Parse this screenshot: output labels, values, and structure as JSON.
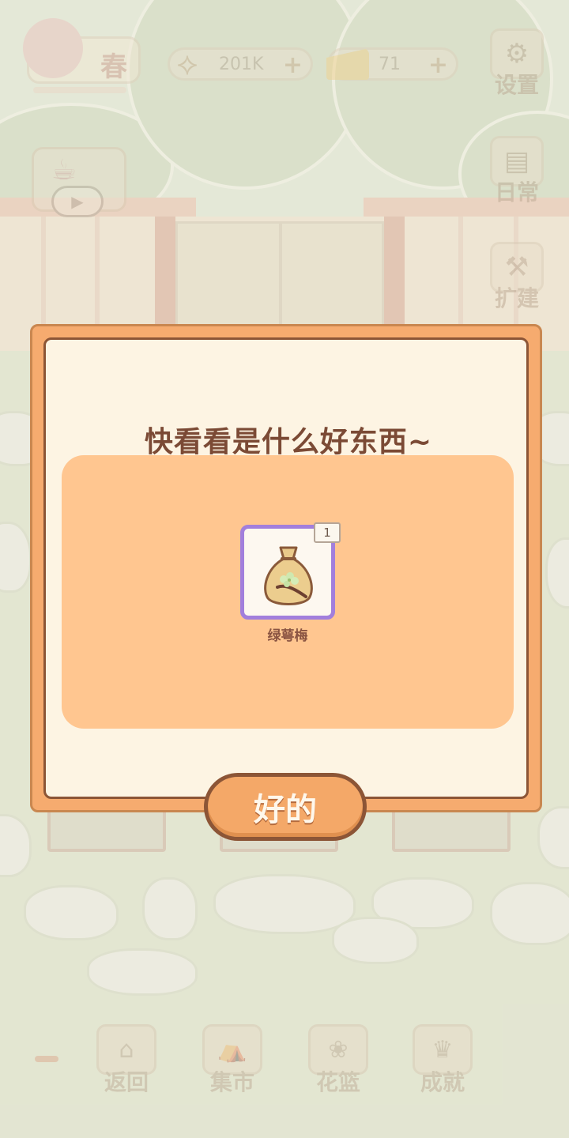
{
  "hud": {
    "season_label": "春",
    "fish_currency": "201K",
    "cheese_currency": "71",
    "plus": "+",
    "settings_label": "设置",
    "daily_label": "日常",
    "build_label": "扩建"
  },
  "nav": {
    "back_label": "返回",
    "market_label": "集市",
    "basket_label": "花篮",
    "achievements_label": "成就"
  },
  "dialog": {
    "title": "快看看是什么好东西~",
    "item": {
      "name": "绿萼梅",
      "count": "1",
      "icon": "seed-bag-icon"
    },
    "ok_label": "好的"
  },
  "colors": {
    "dialog_frame": "#f6ab6f",
    "dialog_border": "#8c5536",
    "dialog_bg": "#fdf4e3",
    "reward_area": "#ffc690",
    "item_border": "#a27fdc",
    "title_text": "#7b4a35"
  }
}
